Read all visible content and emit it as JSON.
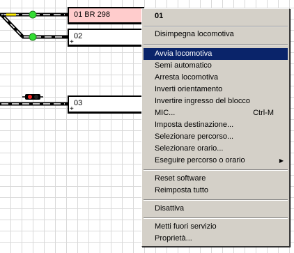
{
  "blocks": [
    {
      "label": "01 BR 298",
      "marker": ""
    },
    {
      "label": "02",
      "marker": "+"
    },
    {
      "label": "03",
      "marker": "+"
    }
  ],
  "context_menu": {
    "header": "01",
    "items": [
      {
        "label": "Disimpegna locomotiva",
        "shortcut": "",
        "submenu": false
      },
      {
        "label": "Avvia locomotiva",
        "shortcut": "",
        "submenu": false
      },
      {
        "label": "Semi automatico",
        "shortcut": "",
        "submenu": false
      },
      {
        "label": "Arresta locomotiva",
        "shortcut": "",
        "submenu": false
      },
      {
        "label": "Inverti orientamento",
        "shortcut": "",
        "submenu": false
      },
      {
        "label": "Invertire ingresso del blocco",
        "shortcut": "",
        "submenu": false
      },
      {
        "label": "MIC...",
        "shortcut": "Ctrl-M",
        "submenu": false
      },
      {
        "label": "Imposta destinazione...",
        "shortcut": "",
        "submenu": false
      },
      {
        "label": "Selezionare percorso...",
        "shortcut": "",
        "submenu": false
      },
      {
        "label": "Selezionare orario...",
        "shortcut": "",
        "submenu": false
      },
      {
        "label": "Eseguire percorso o orario",
        "shortcut": "",
        "submenu": true
      },
      {
        "label": "Reset software",
        "shortcut": "",
        "submenu": false
      },
      {
        "label": "Reimposta tutto",
        "shortcut": "",
        "submenu": false
      },
      {
        "label": "Disattiva",
        "shortcut": "",
        "submenu": false
      },
      {
        "label": "Metti fuori servizio",
        "shortcut": "",
        "submenu": false
      },
      {
        "label": "Proprietà...",
        "shortcut": "",
        "submenu": false
      }
    ]
  },
  "colors": {
    "occupied_block": "#ffcccc",
    "menu_selection": "#0a246a",
    "green_signal": "#33dd33",
    "red_signal": "#ee2222",
    "occupied_track": "#ffee00"
  }
}
